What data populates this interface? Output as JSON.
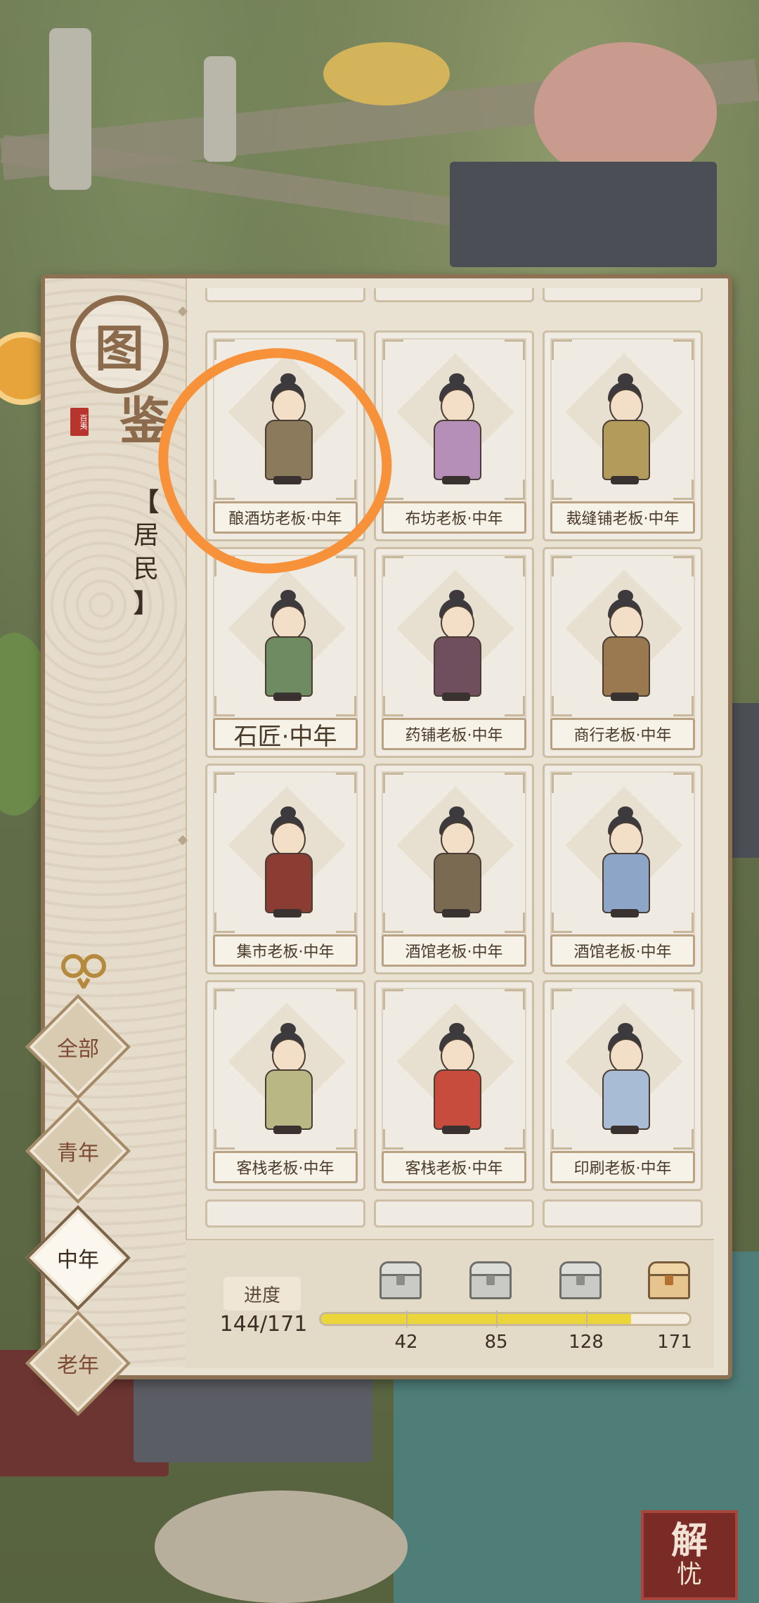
{
  "panel": {
    "title_char1": "图",
    "title_char2": "鉴",
    "chop": "百夷",
    "category": "居民",
    "category_open": "【",
    "category_close": "】"
  },
  "filters": [
    {
      "label": "全部",
      "active": false
    },
    {
      "label": "青年",
      "active": false
    },
    {
      "label": "中年",
      "active": true
    },
    {
      "label": "老年",
      "active": false
    }
  ],
  "cards": [
    {
      "label": "酿酒坊老板·中年",
      "robe": "#8c7a5c"
    },
    {
      "label": "布坊老板·中年",
      "robe": "#b58fb7"
    },
    {
      "label": "裁缝铺老板·中年",
      "robe": "#b39b5c"
    },
    {
      "label": "石匠·中年",
      "robe": "#6f8b62",
      "big": true
    },
    {
      "label": "药铺老板·中年",
      "robe": "#6f4e5d"
    },
    {
      "label": "商行老板·中年",
      "robe": "#9a7850"
    },
    {
      "label": "集市老板·中年",
      "robe": "#8b3d34"
    },
    {
      "label": "酒馆老板·中年",
      "robe": "#7a6a52"
    },
    {
      "label": "酒馆老板·中年",
      "robe": "#8da6c8"
    },
    {
      "label": "客栈老板·中年",
      "robe": "#b9b884"
    },
    {
      "label": "客栈老板·中年",
      "robe": "#c84c3e"
    },
    {
      "label": "印刷老板·中年",
      "robe": "#a9bcd6"
    }
  ],
  "progress": {
    "label": "进度",
    "count": "144/171",
    "current": 144,
    "total": 171,
    "milestones": [
      "42",
      "85",
      "128",
      "171"
    ]
  },
  "corner_stamp": {
    "main": "解",
    "sub": "忧"
  },
  "colors": {
    "annotation": "#f7923a",
    "progress_fill": "#ead63b"
  }
}
